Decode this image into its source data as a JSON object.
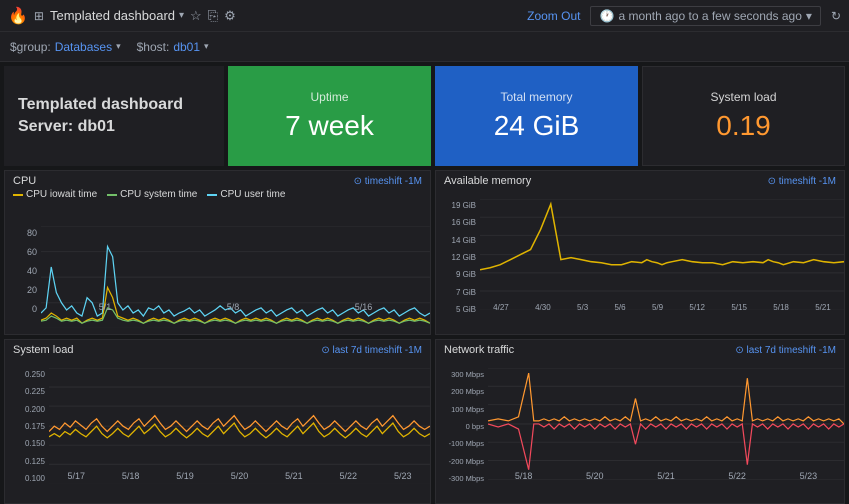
{
  "topbar": {
    "logo": "🔥",
    "title": "Templated dashboard",
    "dropdown_arrow": "▾",
    "icons": [
      "⊞",
      "☁",
      "⚙"
    ],
    "zoom_out": "Zoom Out",
    "time_range": "a month ago to a few seconds ago",
    "clock_icon": "🕐",
    "refresh_icon": "↻"
  },
  "filterbar": {
    "group_label": "$group:",
    "group_value": "Databases",
    "host_label": "$host:",
    "host_value": "db01"
  },
  "info": {
    "title": "Templated dashboard",
    "server": "Server: db01"
  },
  "cards": {
    "uptime": {
      "label": "Uptime",
      "value": "7 week"
    },
    "memory": {
      "label": "Total memory",
      "value": "24 GiB"
    },
    "sysload": {
      "label": "System load",
      "value": "0.19"
    }
  },
  "charts": {
    "cpu": {
      "title": "CPU",
      "meta": "⊙ timeshift -1M",
      "legend": [
        {
          "label": "CPU iowait time",
          "color": "#e0b400"
        },
        {
          "label": "CPU system time",
          "color": "#73bf69"
        },
        {
          "label": "CPU user time",
          "color": "#5ed3f3"
        }
      ],
      "yaxis": [
        "80",
        "60",
        "40",
        "20",
        "0"
      ],
      "xaxis": [
        "5/1",
        "5/8",
        "5/16"
      ]
    },
    "avail_mem": {
      "title": "Available memory",
      "meta": "⊙ timeshift -1M",
      "legend": [],
      "yaxis": [
        "19 GiB",
        "16 GiB",
        "14 GiB",
        "12 GiB",
        "9 GiB",
        "7 GiB",
        "5 GiB"
      ],
      "xaxis": [
        "4/27",
        "4/30",
        "5/3",
        "5/6",
        "5/9",
        "5/12",
        "5/15",
        "5/18",
        "5/21"
      ]
    },
    "sys_load": {
      "title": "System load",
      "meta": "⊙ last 7d timeshift -1M",
      "legend": [],
      "yaxis": [
        "0.250",
        "0.225",
        "0.200",
        "0.175",
        "0.150",
        "0.125",
        "0.100"
      ],
      "xaxis": [
        "5/17",
        "5/18",
        "5/19",
        "5/20",
        "5/21",
        "5/22",
        "5/23"
      ]
    },
    "net_traffic": {
      "title": "Network traffic",
      "meta": "⊙ last 7d timeshift -1M",
      "legend": [],
      "yaxis": [
        "300 Mbps",
        "200 Mbps",
        "100 Mbps",
        "0 bps",
        "-100 Mbps",
        "-200 Mbps",
        "-300 Mbps"
      ],
      "xaxis": [
        "5/18",
        "5/20",
        "5/21",
        "5/22",
        "5/23"
      ]
    }
  }
}
